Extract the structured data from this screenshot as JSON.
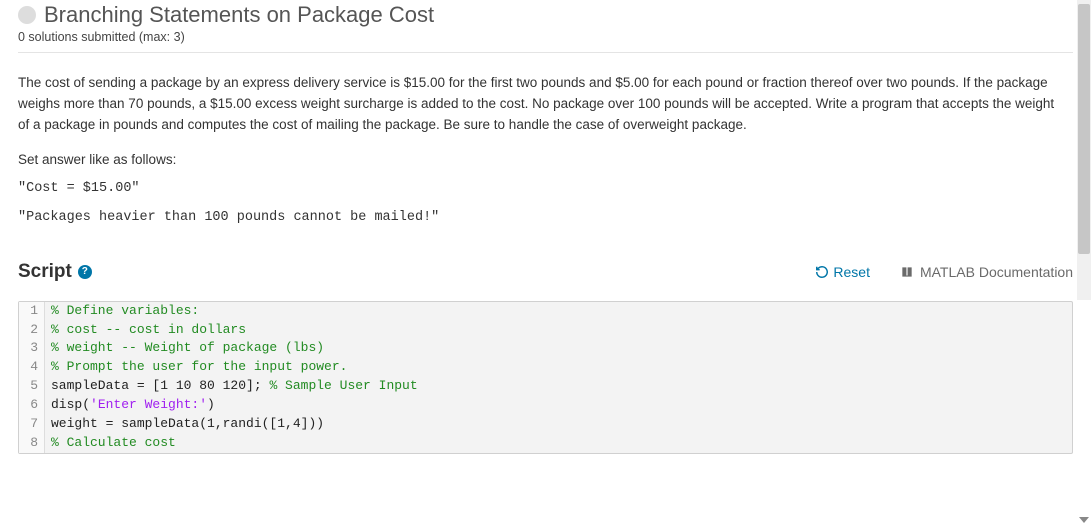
{
  "header": {
    "title": "Branching Statements on Package Cost",
    "subtitle": "0 solutions submitted (max: 3)"
  },
  "problem": {
    "description": "The cost of sending a package by an express delivery service is $15.00 for the first two pounds and $5.00 for each pound or fraction thereof over two pounds. If the package weighs more than 70 pounds, a $15.00 excess weight surcharge is added to the cost. No package over 100 pounds will be accepted. Write a program that accepts the weight of a package in pounds and computes the cost of mailing the package. Be sure to handle the case of overweight package.",
    "set_answer_label": "Set answer like as follows:",
    "example1": "\"Cost = $15.00\"",
    "example2": "\"Packages heavier than 100 pounds cannot be mailed!\""
  },
  "script": {
    "label": "Script",
    "reset_label": "Reset",
    "doc_label": "MATLAB Documentation",
    "code_lines": [
      {
        "n": 1,
        "tokens": [
          {
            "t": "comment",
            "v": "% Define variables:"
          }
        ]
      },
      {
        "n": 2,
        "tokens": [
          {
            "t": "comment",
            "v": "% cost -- cost in dollars"
          }
        ]
      },
      {
        "n": 3,
        "tokens": [
          {
            "t": "comment",
            "v": "% weight -- Weight of package (lbs)"
          }
        ]
      },
      {
        "n": 4,
        "tokens": [
          {
            "t": "comment",
            "v": "% Prompt the user for the input power."
          }
        ]
      },
      {
        "n": 5,
        "tokens": [
          {
            "t": "plain",
            "v": "sampleData = [1 10 80 120]; "
          },
          {
            "t": "comment",
            "v": "% Sample User Input"
          }
        ]
      },
      {
        "n": 6,
        "tokens": [
          {
            "t": "plain",
            "v": "disp("
          },
          {
            "t": "string",
            "v": "'Enter Weight:'"
          },
          {
            "t": "plain",
            "v": ")"
          }
        ]
      },
      {
        "n": 7,
        "tokens": [
          {
            "t": "plain",
            "v": "weight = sampleData(1,randi([1,4]))"
          }
        ]
      },
      {
        "n": 8,
        "tokens": [
          {
            "t": "comment",
            "v": "% Calculate cost"
          }
        ]
      }
    ]
  }
}
